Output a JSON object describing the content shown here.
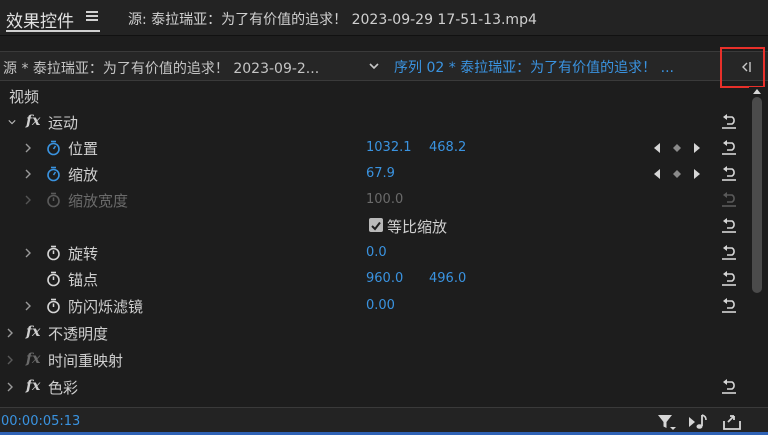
{
  "panel": {
    "title": "效果控件",
    "source_label": "源: 泰拉瑞亚：为了有价值的追求！ 2023-09-29 17-51-13.mp4"
  },
  "toolbar": {
    "source_clip": "源 * 泰拉瑞亚：为了有价值的追求！ 2023-09-2...",
    "sequence_clip": "序列 02 * 泰拉瑞亚：为了有价值的追求！ ..."
  },
  "sections": {
    "video": "视频",
    "motion": "运动",
    "opacity": "不透明度",
    "time_remap": "时间重映射",
    "color": "色彩",
    "fx": "fx"
  },
  "properties": {
    "position": {
      "label": "位置",
      "x": "1032.1",
      "y": "468.2"
    },
    "scale": {
      "label": "缩放",
      "value": "67.9"
    },
    "scale_width": {
      "label": "缩放宽度",
      "value": "100.0"
    },
    "uniform_scale": {
      "label": "等比缩放",
      "checked": true
    },
    "rotation": {
      "label": "旋转",
      "value": "0.0"
    },
    "anchor": {
      "label": "锚点",
      "x": "960.0",
      "y": "496.0"
    },
    "anti_flicker": {
      "label": "防闪烁滤镜",
      "value": "0.00"
    }
  },
  "footer": {
    "timecode": "00:00:05:13"
  },
  "colors": {
    "accent": "#3a93e0",
    "highlight": "#e8302a",
    "background": "#1d1d1d"
  },
  "icons": [
    "panel-menu-icon",
    "dropdown-icon",
    "expand-icon",
    "chevron-right-icon",
    "chevron-down-icon",
    "stopwatch-icon",
    "keyframe-prev-icon",
    "keyframe-add-icon",
    "keyframe-next-icon",
    "reset-icon",
    "filter-icon",
    "play-audio-icon",
    "export-icon"
  ]
}
